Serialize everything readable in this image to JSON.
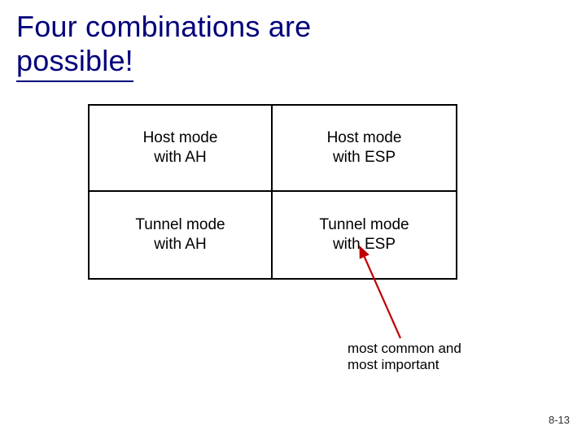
{
  "slide": {
    "title_line1": "Four combinations are",
    "title_line2": "possible!",
    "table": {
      "r0c0_l1": "Host mode",
      "r0c0_l2": "with AH",
      "r0c1_l1": "Host mode",
      "r0c1_l2": "with ESP",
      "r1c0_l1": "Tunnel mode",
      "r1c0_l2": "with AH",
      "r1c1_l1": "Tunnel mode",
      "r1c1_l2": "with ESP"
    },
    "annotation_l1": "most common and",
    "annotation_l2": "most important",
    "page_number": "8-13",
    "arrow_color": "#c00000"
  }
}
